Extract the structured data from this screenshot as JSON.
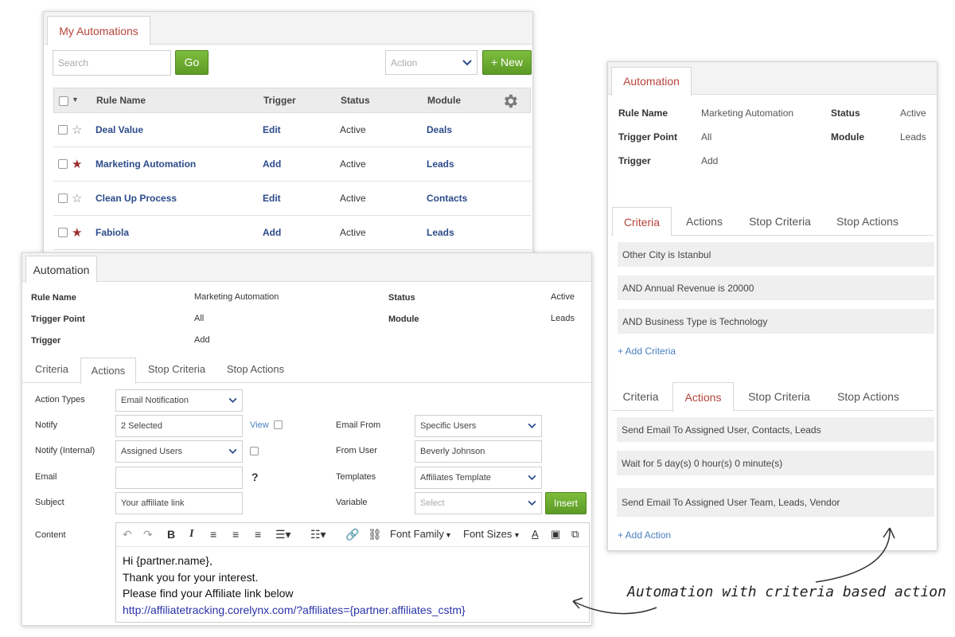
{
  "list_panel": {
    "tab": "My Automations",
    "search_placeholder": "Search",
    "go_label": "Go",
    "action_placeholder": "Action",
    "new_label": "+ New",
    "columns": [
      "Rule Name",
      "Trigger",
      "Status",
      "Module"
    ],
    "rows": [
      {
        "name": "Deal Value",
        "trigger": "Edit",
        "status": "Active",
        "module": "Deals",
        "starred": false
      },
      {
        "name": "Marketing Automation",
        "trigger": "Add",
        "status": "Active",
        "module": "Leads",
        "starred": true
      },
      {
        "name": "Clean Up Process",
        "trigger": "Edit",
        "status": "Active",
        "module": "Contacts",
        "starred": false
      },
      {
        "name": "Fabiola",
        "trigger": "Add",
        "status": "Active",
        "module": "Leads",
        "starred": true
      }
    ]
  },
  "detail_panel": {
    "tab": "Automation",
    "fields": {
      "rule_name_label": "Rule Name",
      "rule_name": "Marketing Automation",
      "status_label": "Status",
      "status": "Active",
      "trigger_point_label": "Trigger Point",
      "trigger_point": "All",
      "module_label": "Module",
      "module": "Leads",
      "trigger_label": "Trigger",
      "trigger": "Add"
    },
    "tabs": [
      "Criteria",
      "Actions",
      "Stop Criteria",
      "Stop Actions"
    ],
    "form": {
      "action_types_label": "Action Types",
      "action_types": "Email Notification",
      "notify_label": "Notify",
      "notify": "2 Selected",
      "view_label": "View",
      "email_from_label": "Email From",
      "email_from": "Specific Users",
      "notify_internal_label": "Notify (Internal)",
      "notify_internal": "Assigned Users",
      "from_user_label": "From User",
      "from_user": "Beverly Johnson",
      "email_label": "Email",
      "help": "?",
      "templates_label": "Templates",
      "templates": "Affiliates Template",
      "subject_label": "Subject",
      "subject": "Your affiliate link",
      "variable_label": "Variable",
      "variable_placeholder": "Select",
      "insert_label": "Insert",
      "content_label": "Content"
    },
    "toolbar": {
      "font_family": "Font Family",
      "font_sizes": "Font Sizes"
    },
    "content": {
      "line1": "Hi {partner.name},",
      "line2": "Thank you for your interest.",
      "line3": "Please find your Affiliate link below",
      "link": "http://affiliatetracking.corelynx.com/?affiliates={partner.affiliates_cstm}"
    }
  },
  "right_panel": {
    "tab": "Automation",
    "fields": {
      "rule_name_label": "Rule Name",
      "rule_name": "Marketing Automation",
      "status_label": "Status",
      "status": "Active",
      "trigger_point_label": "Trigger Point",
      "trigger_point": "All",
      "module_label": "Module",
      "module": "Leads",
      "trigger_label": "Trigger",
      "trigger": "Add"
    },
    "criteria_tabs": [
      "Criteria",
      "Actions",
      "Stop Criteria",
      "Stop Actions"
    ],
    "criteria": [
      "Other City is Istanbul",
      "AND Annual Revenue is 20000",
      "AND Business Type is Technology"
    ],
    "add_criteria": "+ Add Criteria",
    "action_tabs": [
      "Criteria",
      "Actions",
      "Stop Criteria",
      "Stop Actions"
    ],
    "actions": [
      "Send Email To Assigned User, Contacts, Leads",
      "Wait for 5 day(s) 0 hour(s) 0 minute(s)",
      "Send Email To Assigned User Team, Leads, Vendor"
    ],
    "add_action": "+ Add Action"
  },
  "caption": "Automation with criteria based action"
}
